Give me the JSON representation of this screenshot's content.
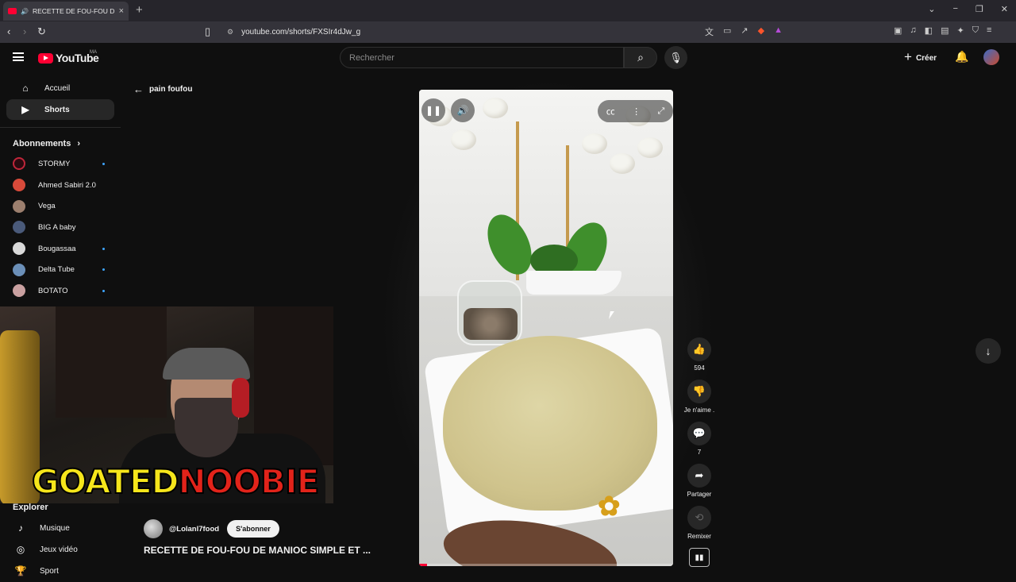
{
  "browser": {
    "tab_title": "RECETTE DE FOU-FOU DE MANIOC",
    "url": "youtube.com/shorts/FXSIr4dJw_g",
    "new_tab": "+"
  },
  "topbar": {
    "logo_text": "YouTube",
    "logo_country": "MA",
    "search_placeholder": "Rechercher",
    "create_label": "Créer"
  },
  "sidebar": {
    "items": [
      {
        "label": "Accueil",
        "icon": "home-icon"
      },
      {
        "label": "Shorts",
        "icon": "shorts-icon",
        "active": true
      }
    ],
    "subscriptions_heading": "Abonnements",
    "subscriptions": [
      {
        "name": "STORMY",
        "new": true,
        "color": "#c0263a"
      },
      {
        "name": "Ahmed Sabiri 2.0",
        "new": false,
        "color": "#d84a3a"
      },
      {
        "name": "Vega",
        "new": false,
        "color": "#9c7f6e"
      },
      {
        "name": "BIG A baby",
        "new": false,
        "color": "#4a5a7a"
      },
      {
        "name": "Bougassaa",
        "new": true,
        "color": "#d9d9d9"
      },
      {
        "name": "Delta Tube",
        "new": true,
        "color": "#6b8fb8"
      },
      {
        "name": "BOTATO",
        "new": true,
        "color": "#c9a0a0"
      }
    ],
    "explorer_heading": "Explorer",
    "explorer": [
      {
        "label": "Musique",
        "icon": "music-note-icon"
      },
      {
        "label": "Jeux vidéo",
        "icon": "gamepad-icon"
      },
      {
        "label": "Sport",
        "icon": "trophy-icon"
      }
    ]
  },
  "overlay": {
    "brand_part1": "GOATED",
    "brand_part2": "NOOBIE"
  },
  "short": {
    "back_label": "pain foufou",
    "channel_handle": "@Lolanl7food",
    "subscribe_label": "S'abonner",
    "title": "RECETTE DE FOU-FOU DE MANIOC SIMPLE ET ...",
    "progress": 0.03,
    "actions": {
      "likes": "594",
      "dislike_label": "Je n'aime .",
      "comments": "7",
      "share_label": "Partager",
      "remix_label": "Remixer"
    }
  },
  "colors": {
    "accent": "#ff0033",
    "background": "#0f0f0f",
    "new_dot": "#3ea6ff"
  }
}
